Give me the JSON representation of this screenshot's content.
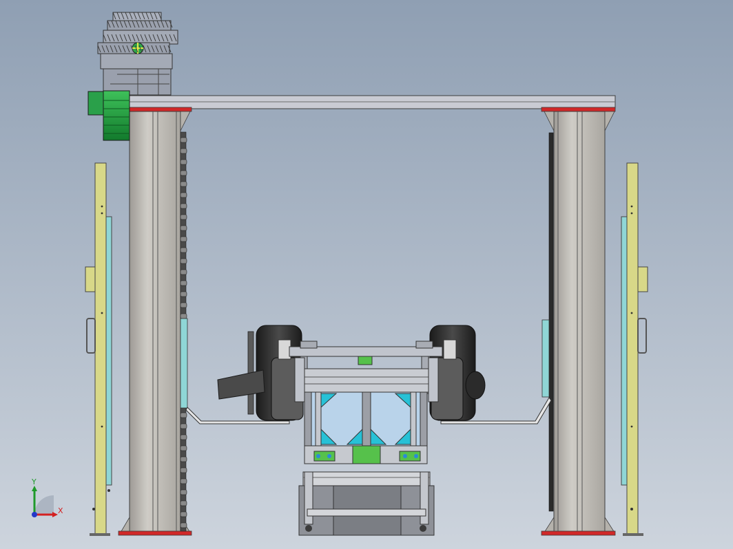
{
  "viewport": {
    "background_top": "#8f9fb3",
    "background_bottom": "#cdd4dd"
  },
  "triad": {
    "x_label": "X",
    "y_label": "Y",
    "x_color": "#d42020",
    "y_color": "#1f9a2a",
    "z_color": "#2438c8"
  },
  "colors": {
    "column": "#bdbab4",
    "column_edge": "#4a4a4a",
    "red_cap": "#d02828",
    "guide_yellow": "#d8d888",
    "guide_cyan": "#8fd6d6",
    "motor_green": "#1f9a3e",
    "gearbox": "#9aa0ad",
    "tire": "#2b2b2b",
    "cart_blue": "#b9d3ea",
    "bracket_cyan": "#27c1d6",
    "plate_green": "#56c14b"
  }
}
